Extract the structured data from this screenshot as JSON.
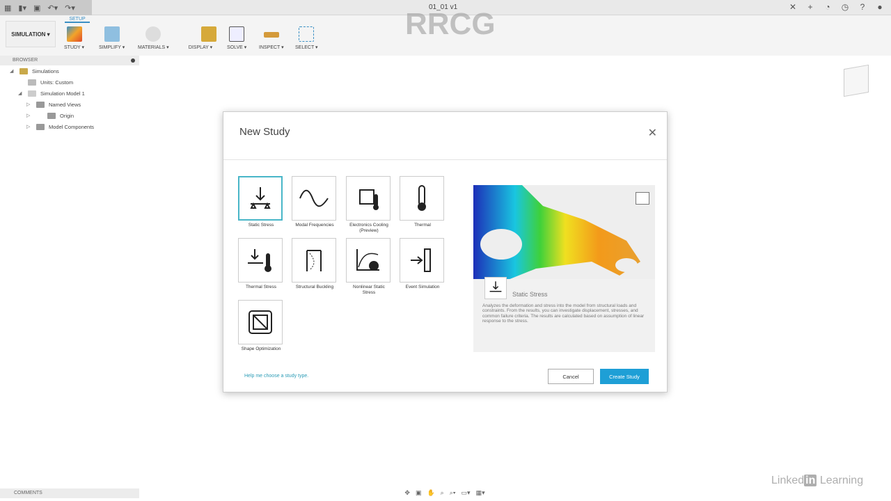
{
  "window": {
    "doc_title": "01_01 v1"
  },
  "toolbar": {
    "workspace": "SIMULATION ▾",
    "tab": "SETUP",
    "tools": [
      "STUDY ▾",
      "SIMPLIFY ▾",
      "MATERIALS ▾",
      "DISPLAY ▾",
      "SOLVE ▾",
      "INSPECT ▾",
      "SELECT ▾"
    ]
  },
  "browser": {
    "title": "BROWSER",
    "nodes": [
      "Simulations",
      "Units: Custom",
      "Simulation Model 1",
      "Named Views",
      "Origin",
      "Model Components"
    ],
    "comments": "COMMENTS"
  },
  "dialog": {
    "title": "New Study",
    "studies": [
      "Static Stress",
      "Modal Frequencies",
      "Electronics Cooling (Preview)",
      "Thermal",
      "Thermal Stress",
      "Structural Buckling",
      "Nonlinear Static Stress",
      "Event Simulation",
      "Shape Optimization"
    ],
    "preview_title": "Static Stress",
    "preview_desc": "Analyzes the deformation and stress into the model from structural loads and constraints. From the results, you can investigate displacement, stresses, and common failure criteria. The results are calculated based on assumption of linear response to the stress.",
    "help_link": "Help me choose a study type.",
    "cancel": "Cancel",
    "create": "Create Study"
  },
  "watermark": {
    "text": "RRCG",
    "brand": "Linked",
    "brand_in": "in",
    "brand_tail": " Learning"
  },
  "colors": {
    "accent": "#1e9fd6",
    "selected": "#48b6c8"
  }
}
